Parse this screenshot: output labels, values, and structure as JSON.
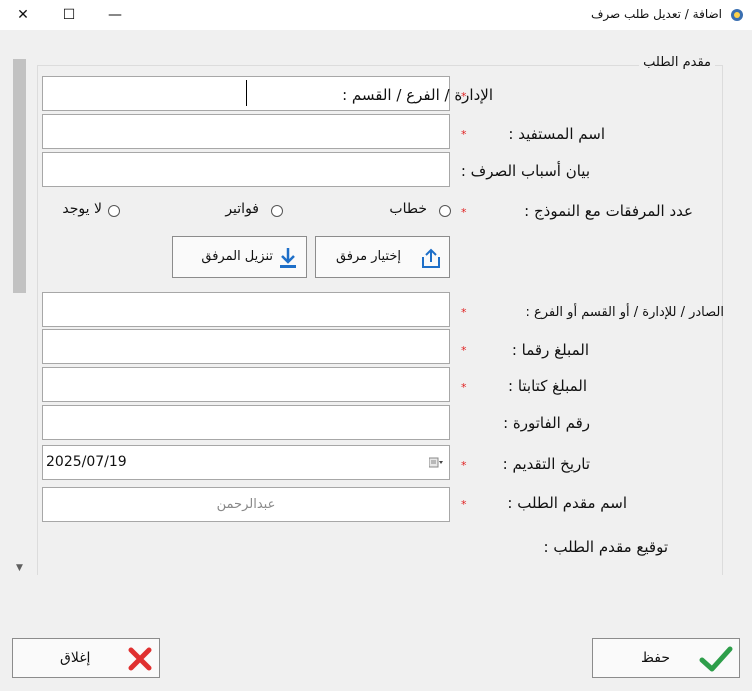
{
  "window": {
    "title": "اضافة / تعديل طلب صرف",
    "close_symbol": "✕",
    "maximize_symbol": "☐",
    "minimize_symbol": "—"
  },
  "group": {
    "title": "مقدم الطلب"
  },
  "labels": {
    "department": "الإدارة / الفرع / القسم :",
    "beneficiary": "اسم المستفيد :",
    "reason": "بيان أسباب الصرف :",
    "attachments": "عدد المرفقات مع النموذج :",
    "issuer": "الصادر / للإدارة / أو القسم أو الفرع :",
    "amount_numeric": "المبلغ رقما :",
    "amount_text": "المبلغ كتابتا :",
    "invoice_number": "رقم الفاتورة :",
    "submission_date": "تاريخ التقديم :",
    "applicant_name": "اسم مقدم الطلب :",
    "applicant_signature": "توقيع مقدم الطلب :"
  },
  "required_mark": "*",
  "radio_options": [
    "خطاب",
    "فواتير",
    "لا يوجد"
  ],
  "buttons": {
    "choose_attachment": "إختيار مرفق",
    "download_attachment": "تنزيل المرفق",
    "save": "حفظ",
    "close": "إغلاق"
  },
  "fields": {
    "department": "",
    "beneficiary": "",
    "reason": "",
    "issuer": "",
    "amount_numeric": "",
    "amount_text": "",
    "invoice_number": "",
    "submission_date": "2025/07/19",
    "applicant_name": "عبدالرحمن"
  },
  "colors": {
    "required": "#e02020",
    "save_check": "#2e9e4a",
    "close_x": "#e03030",
    "icon_blue": "#1e6fc8"
  }
}
